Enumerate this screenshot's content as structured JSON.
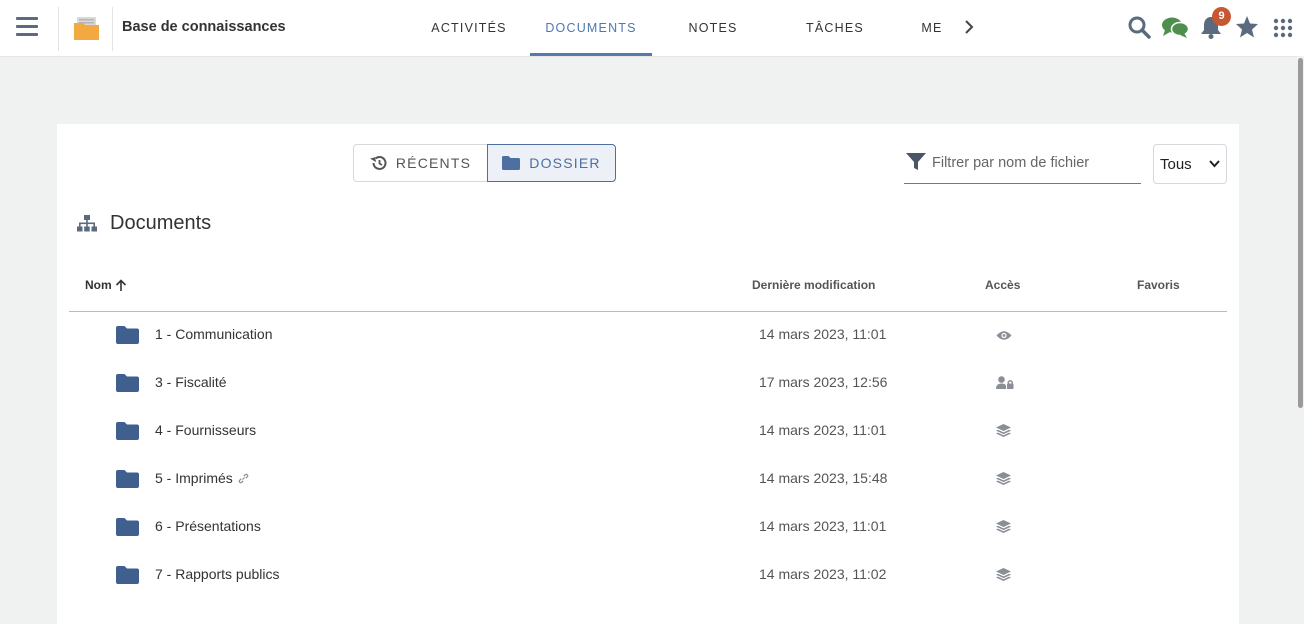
{
  "header": {
    "app_title": "Base de connaissances",
    "tabs": [
      {
        "label": "ACTIVITÉS"
      },
      {
        "label": "DOCUMENTS"
      },
      {
        "label": "NOTES"
      },
      {
        "label": "TÂCHES"
      },
      {
        "label": "ME"
      }
    ],
    "active_tab": "DOCUMENTS",
    "notification_count": "9",
    "icons": [
      "menu-icon",
      "folder-app-icon",
      "chevron-right-icon",
      "search-icon",
      "chat-icon",
      "bell-icon",
      "star-icon",
      "apps-grid-icon"
    ]
  },
  "toolbar": {
    "recents_label": "RÉCENTS",
    "dossier_label": "DOSSIER",
    "filter_placeholder": "Filtrer par nom de fichier",
    "filter_value": "",
    "scope_select": "Tous"
  },
  "section": {
    "title": "Documents"
  },
  "table": {
    "columns": {
      "name": "Nom",
      "modified": "Dernière modification",
      "access": "Accès",
      "favorites": "Favoris"
    },
    "sort": "ascending",
    "rows": [
      {
        "name": "1 - Communication",
        "modified": "14 mars 2023, 11:01",
        "access_icon": "eye-icon",
        "linked": false
      },
      {
        "name": "3 - Fiscalité",
        "modified": "17 mars 2023, 12:56",
        "access_icon": "user-lock-icon",
        "linked": false
      },
      {
        "name": "4 - Fournisseurs",
        "modified": "14 mars 2023, 11:01",
        "access_icon": "layers-icon",
        "linked": false
      },
      {
        "name": "5 - Imprimés",
        "modified": "14 mars 2023, 15:48",
        "access_icon": "layers-icon",
        "linked": true
      },
      {
        "name": "6 - Présentations",
        "modified": "14 mars 2023, 11:01",
        "access_icon": "layers-icon",
        "linked": false
      },
      {
        "name": "7 - Rapports publics",
        "modified": "14 mars 2023, 11:02",
        "access_icon": "layers-icon",
        "linked": false
      }
    ]
  },
  "colors": {
    "accent": "#5779ad",
    "folder": "#3f5f8f",
    "badge": "#c75733",
    "chat": "#4e8f4e",
    "icon": "#5b6b7f"
  }
}
